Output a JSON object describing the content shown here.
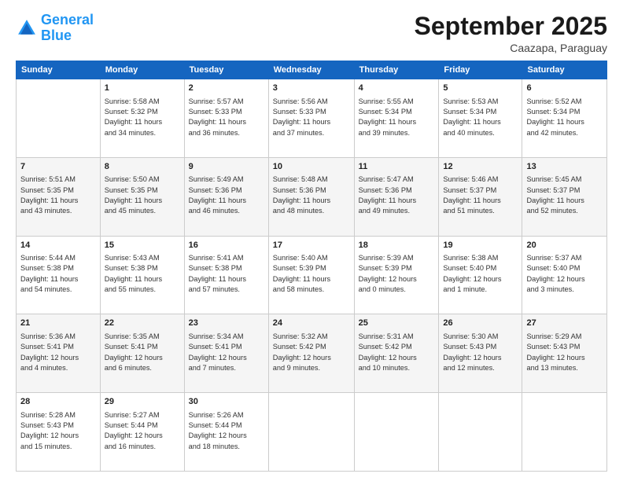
{
  "header": {
    "logo_line1": "General",
    "logo_line2": "Blue",
    "month_title": "September 2025",
    "location": "Caazapa, Paraguay"
  },
  "days_of_week": [
    "Sunday",
    "Monday",
    "Tuesday",
    "Wednesday",
    "Thursday",
    "Friday",
    "Saturday"
  ],
  "weeks": [
    [
      {
        "day": "",
        "info": ""
      },
      {
        "day": "1",
        "info": "Sunrise: 5:58 AM\nSunset: 5:32 PM\nDaylight: 11 hours\nand 34 minutes."
      },
      {
        "day": "2",
        "info": "Sunrise: 5:57 AM\nSunset: 5:33 PM\nDaylight: 11 hours\nand 36 minutes."
      },
      {
        "day": "3",
        "info": "Sunrise: 5:56 AM\nSunset: 5:33 PM\nDaylight: 11 hours\nand 37 minutes."
      },
      {
        "day": "4",
        "info": "Sunrise: 5:55 AM\nSunset: 5:34 PM\nDaylight: 11 hours\nand 39 minutes."
      },
      {
        "day": "5",
        "info": "Sunrise: 5:53 AM\nSunset: 5:34 PM\nDaylight: 11 hours\nand 40 minutes."
      },
      {
        "day": "6",
        "info": "Sunrise: 5:52 AM\nSunset: 5:34 PM\nDaylight: 11 hours\nand 42 minutes."
      }
    ],
    [
      {
        "day": "7",
        "info": "Sunrise: 5:51 AM\nSunset: 5:35 PM\nDaylight: 11 hours\nand 43 minutes."
      },
      {
        "day": "8",
        "info": "Sunrise: 5:50 AM\nSunset: 5:35 PM\nDaylight: 11 hours\nand 45 minutes."
      },
      {
        "day": "9",
        "info": "Sunrise: 5:49 AM\nSunset: 5:36 PM\nDaylight: 11 hours\nand 46 minutes."
      },
      {
        "day": "10",
        "info": "Sunrise: 5:48 AM\nSunset: 5:36 PM\nDaylight: 11 hours\nand 48 minutes."
      },
      {
        "day": "11",
        "info": "Sunrise: 5:47 AM\nSunset: 5:36 PM\nDaylight: 11 hours\nand 49 minutes."
      },
      {
        "day": "12",
        "info": "Sunrise: 5:46 AM\nSunset: 5:37 PM\nDaylight: 11 hours\nand 51 minutes."
      },
      {
        "day": "13",
        "info": "Sunrise: 5:45 AM\nSunset: 5:37 PM\nDaylight: 11 hours\nand 52 minutes."
      }
    ],
    [
      {
        "day": "14",
        "info": "Sunrise: 5:44 AM\nSunset: 5:38 PM\nDaylight: 11 hours\nand 54 minutes."
      },
      {
        "day": "15",
        "info": "Sunrise: 5:43 AM\nSunset: 5:38 PM\nDaylight: 11 hours\nand 55 minutes."
      },
      {
        "day": "16",
        "info": "Sunrise: 5:41 AM\nSunset: 5:38 PM\nDaylight: 11 hours\nand 57 minutes."
      },
      {
        "day": "17",
        "info": "Sunrise: 5:40 AM\nSunset: 5:39 PM\nDaylight: 11 hours\nand 58 minutes."
      },
      {
        "day": "18",
        "info": "Sunrise: 5:39 AM\nSunset: 5:39 PM\nDaylight: 12 hours\nand 0 minutes."
      },
      {
        "day": "19",
        "info": "Sunrise: 5:38 AM\nSunset: 5:40 PM\nDaylight: 12 hours\nand 1 minute."
      },
      {
        "day": "20",
        "info": "Sunrise: 5:37 AM\nSunset: 5:40 PM\nDaylight: 12 hours\nand 3 minutes."
      }
    ],
    [
      {
        "day": "21",
        "info": "Sunrise: 5:36 AM\nSunset: 5:41 PM\nDaylight: 12 hours\nand 4 minutes."
      },
      {
        "day": "22",
        "info": "Sunrise: 5:35 AM\nSunset: 5:41 PM\nDaylight: 12 hours\nand 6 minutes."
      },
      {
        "day": "23",
        "info": "Sunrise: 5:34 AM\nSunset: 5:41 PM\nDaylight: 12 hours\nand 7 minutes."
      },
      {
        "day": "24",
        "info": "Sunrise: 5:32 AM\nSunset: 5:42 PM\nDaylight: 12 hours\nand 9 minutes."
      },
      {
        "day": "25",
        "info": "Sunrise: 5:31 AM\nSunset: 5:42 PM\nDaylight: 12 hours\nand 10 minutes."
      },
      {
        "day": "26",
        "info": "Sunrise: 5:30 AM\nSunset: 5:43 PM\nDaylight: 12 hours\nand 12 minutes."
      },
      {
        "day": "27",
        "info": "Sunrise: 5:29 AM\nSunset: 5:43 PM\nDaylight: 12 hours\nand 13 minutes."
      }
    ],
    [
      {
        "day": "28",
        "info": "Sunrise: 5:28 AM\nSunset: 5:43 PM\nDaylight: 12 hours\nand 15 minutes."
      },
      {
        "day": "29",
        "info": "Sunrise: 5:27 AM\nSunset: 5:44 PM\nDaylight: 12 hours\nand 16 minutes."
      },
      {
        "day": "30",
        "info": "Sunrise: 5:26 AM\nSunset: 5:44 PM\nDaylight: 12 hours\nand 18 minutes."
      },
      {
        "day": "",
        "info": ""
      },
      {
        "day": "",
        "info": ""
      },
      {
        "day": "",
        "info": ""
      },
      {
        "day": "",
        "info": ""
      }
    ]
  ]
}
